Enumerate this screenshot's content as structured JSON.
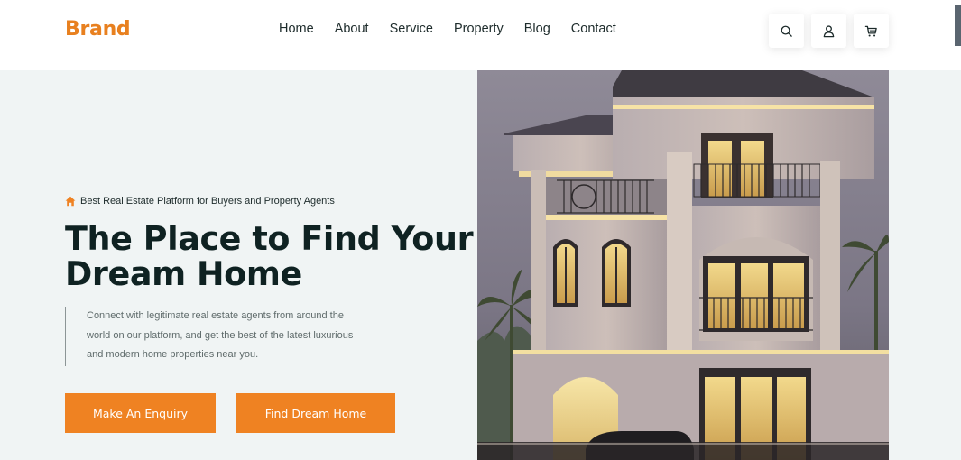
{
  "brand": {
    "name": "Brand"
  },
  "nav": {
    "items": [
      {
        "label": "Home"
      },
      {
        "label": "About"
      },
      {
        "label": "Service"
      },
      {
        "label": "Property"
      },
      {
        "label": "Blog"
      },
      {
        "label": "Contact"
      }
    ]
  },
  "header_icons": [
    "search-icon",
    "user-icon",
    "cart-icon"
  ],
  "hero": {
    "tagline": "Best Real Estate Platform for Buyers and Property Agents",
    "tagline_icon": "home-icon",
    "title_line1": "The Place to Find Your",
    "title_line2": "Dream Home",
    "description_line1": "Connect with legitimate real estate agents from around the",
    "description_line2": "world on our platform, and get the best of the latest luxurious",
    "description_line3": "and modern home properties near you.",
    "buttons": {
      "enquiry": "Make An Enquiry",
      "find": "Find Dream Home"
    }
  },
  "colors": {
    "accent": "#ef8222",
    "brand": "#e8801f",
    "heading": "#0f2222",
    "hero_bg": "#f0f4f4"
  }
}
